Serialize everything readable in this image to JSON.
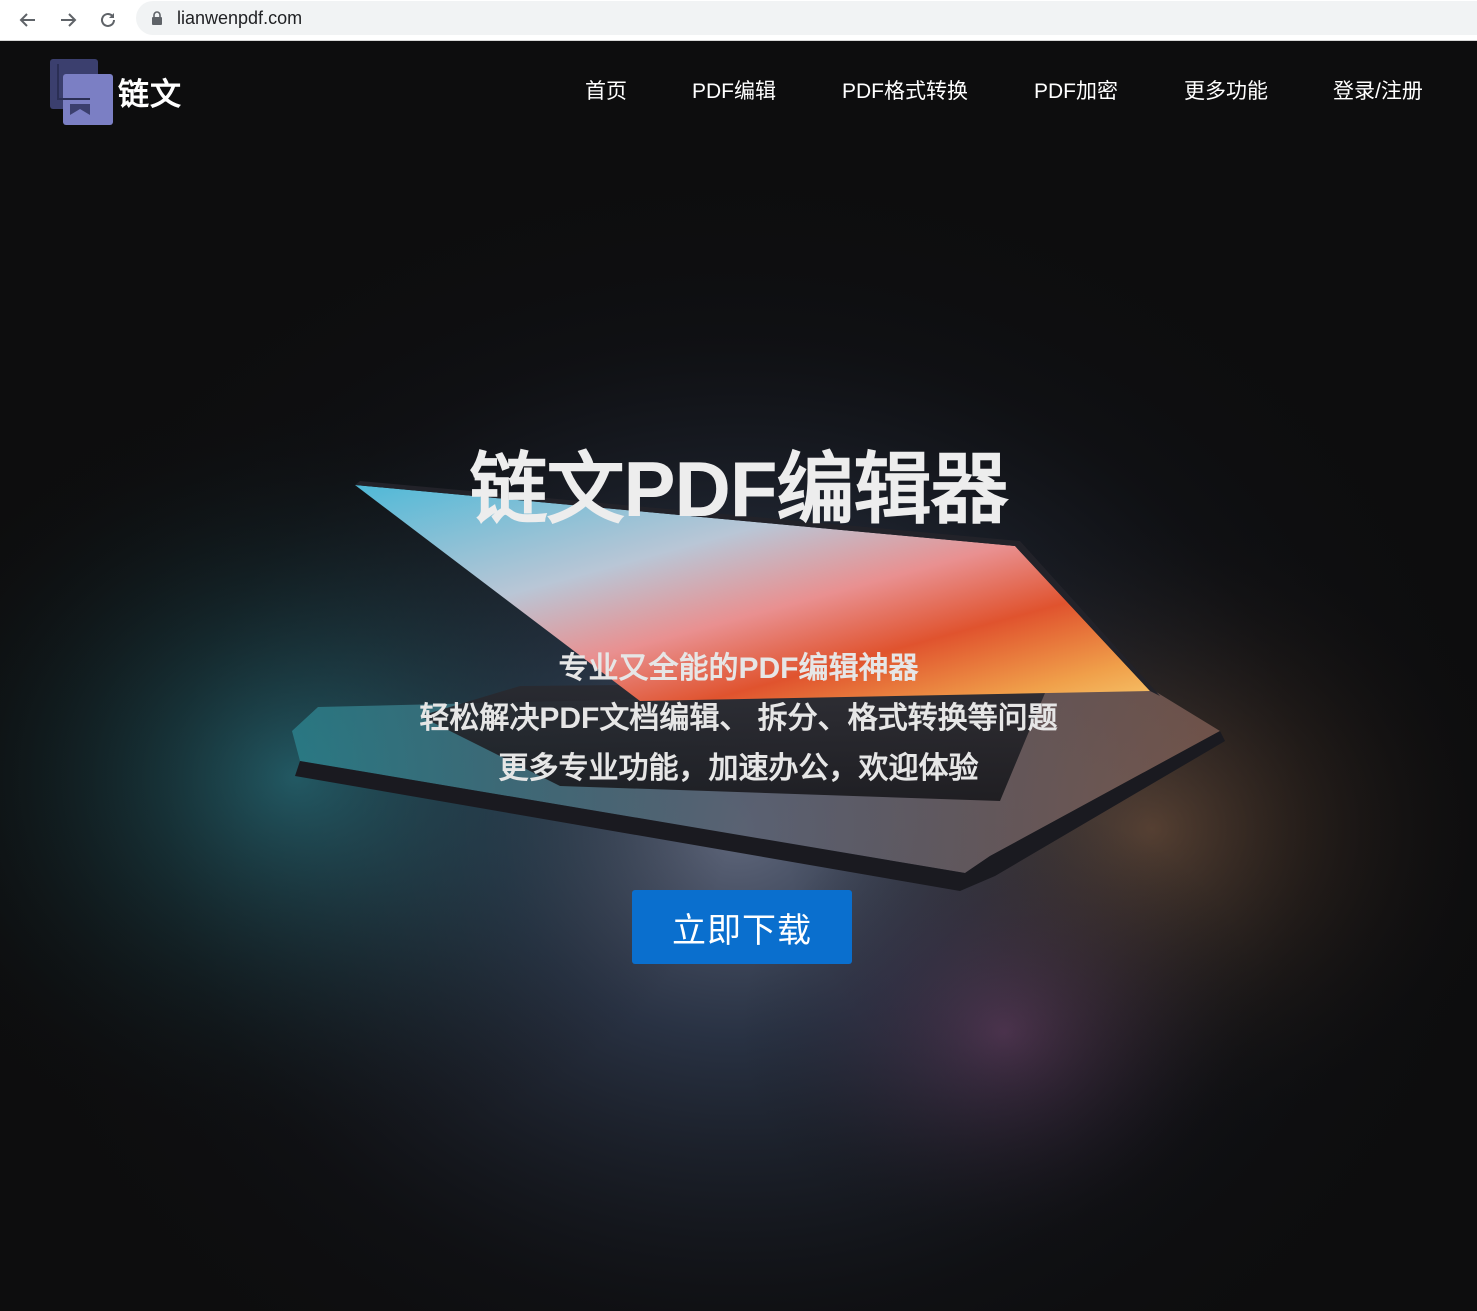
{
  "browser": {
    "url": "lianwenpdf.com"
  },
  "site": {
    "logo_text": "链文",
    "nav": [
      {
        "label": "首页"
      },
      {
        "label": "PDF编辑"
      },
      {
        "label": "PDF格式转换"
      },
      {
        "label": "PDF加密"
      },
      {
        "label": "更多功能"
      },
      {
        "label": "登录/注册"
      }
    ]
  },
  "hero": {
    "title": "链文PDF编辑器",
    "lines": [
      "专业又全能的PDF编辑神器",
      "轻松解决PDF文档编辑、 拆分、格式转换等问题",
      "更多专业功能，加速办公，欢迎体验"
    ],
    "cta_label": "立即下载"
  },
  "colors": {
    "background": "#0d0d0e",
    "cta": "#0a6fce",
    "logo_dark": "#3b3f6e",
    "logo_light": "#7b7fc4"
  }
}
